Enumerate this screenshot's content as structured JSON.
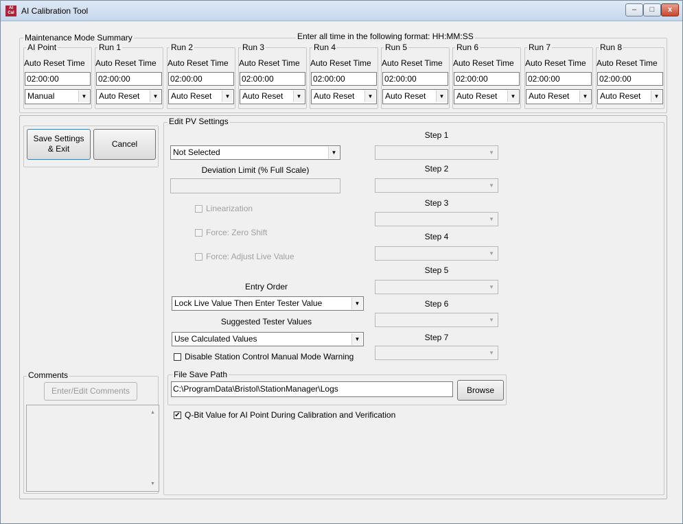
{
  "window": {
    "title": "AI Calibration Tool",
    "icon_text": "AI Cal",
    "minimize": "–",
    "maximize": "□",
    "close": "x"
  },
  "maintenance": {
    "legend": "Maintenance Mode Summary",
    "format_note": "Enter all time in the following format:  HH:MM:SS",
    "columns": [
      {
        "header": "AI Point",
        "label": "Auto Reset Time",
        "time": "02:00:00",
        "mode": "Manual"
      },
      {
        "header": "Run 1",
        "label": "Auto Reset Time",
        "time": "02:00:00",
        "mode": "Auto Reset"
      },
      {
        "header": "Run 2",
        "label": "Auto Reset Time",
        "time": "02:00:00",
        "mode": "Auto Reset"
      },
      {
        "header": "Run 3",
        "label": "Auto Reset Time",
        "time": "02:00:00",
        "mode": "Auto Reset"
      },
      {
        "header": "Run 4",
        "label": "Auto Reset Time",
        "time": "02:00:00",
        "mode": "Auto Reset"
      },
      {
        "header": "Run 5",
        "label": "Auto Reset Time",
        "time": "02:00:00",
        "mode": "Auto Reset"
      },
      {
        "header": "Run 6",
        "label": "Auto Reset Time",
        "time": "02:00:00",
        "mode": "Auto Reset"
      },
      {
        "header": "Run 7",
        "label": "Auto Reset Time",
        "time": "02:00:00",
        "mode": "Auto Reset"
      },
      {
        "header": "Run 8",
        "label": "Auto Reset Time",
        "time": "02:00:00",
        "mode": "Auto Reset"
      }
    ]
  },
  "actions": {
    "save_line1": "Save Settings",
    "save_line2": "& Exit",
    "cancel": "Cancel"
  },
  "comments": {
    "legend": "Comments",
    "edit_button": "Enter/Edit Comments",
    "text": ""
  },
  "pv": {
    "legend": "Edit PV Settings",
    "pv_select": "Not Selected",
    "deviation_label": "Deviation Limit (% Full Scale)",
    "deviation_value": "",
    "linearization": "Linearization",
    "force_zero_shift": "Force: Zero Shift",
    "force_adjust_live": "Force: Adjust Live Value",
    "entry_order_label": "Entry Order",
    "entry_order_value": "Lock Live Value Then Enter Tester Value",
    "suggested_label": "Suggested Tester Values",
    "suggested_value": "Use Calculated Values",
    "disable_warning": "Disable Station Control Manual Mode Warning",
    "disable_warning_checked": false,
    "steps": [
      "Step 1",
      "Step 2",
      "Step 3",
      "Step 4",
      "Step 5",
      "Step 6",
      "Step 7"
    ]
  },
  "file_save": {
    "legend": "File Save Path",
    "path": "C:\\ProgramData\\Bristol\\StationManager\\Logs",
    "browse": "Browse"
  },
  "qbit": {
    "label": "Q-Bit Value for AI Point During Calibration and Verification",
    "checked": true
  }
}
